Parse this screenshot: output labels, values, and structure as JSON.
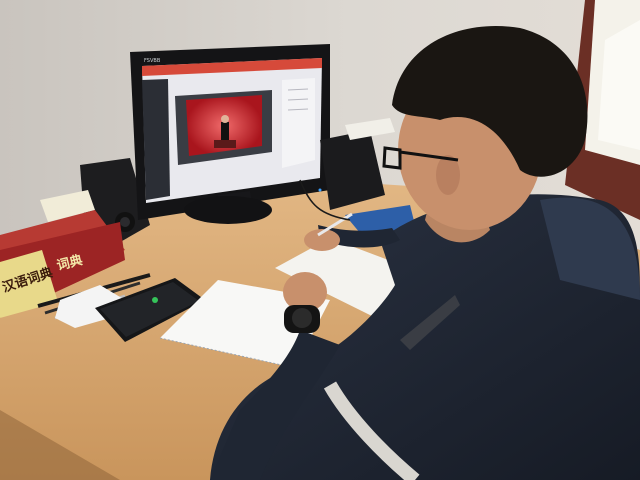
{
  "scene": {
    "description_label": "",
    "dictionary": {
      "spine_text_1": "汉语词典",
      "spine_text_2": "词典",
      "colors": {
        "cover": "#a32a2a",
        "band": "#e8d98a"
      }
    },
    "monitor": {
      "top_label": "FSVBB",
      "screen_colors": {
        "background": "#e9e9ee",
        "video_bg": "#b41e26",
        "sidebar": "#2b2e35"
      }
    },
    "wall_color": "#d6d1cb",
    "desk_color": "#d9ab74",
    "person": {
      "jacket_color": "#1f2633",
      "hair_color": "#1a1612"
    }
  }
}
